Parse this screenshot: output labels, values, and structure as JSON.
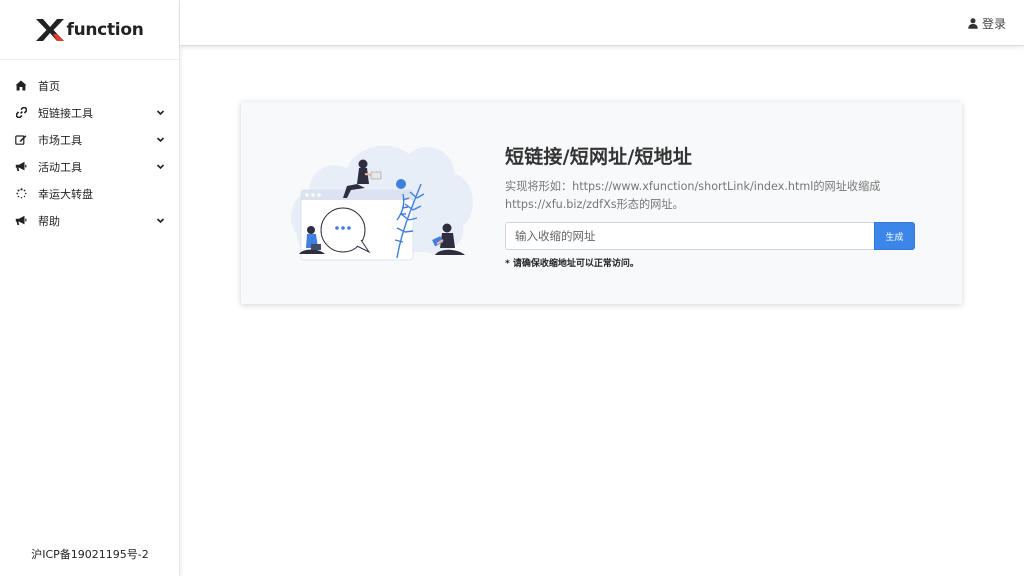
{
  "brand": {
    "logo_text": "function",
    "accent": "#e23b2b"
  },
  "sidebar": {
    "items": [
      {
        "label": "首页",
        "icon": "home-icon",
        "has_submenu": false
      },
      {
        "label": "短链接工具",
        "icon": "link-icon",
        "has_submenu": true
      },
      {
        "label": "市场工具",
        "icon": "edit-icon",
        "has_submenu": true
      },
      {
        "label": "活动工具",
        "icon": "megaphone-icon",
        "has_submenu": true
      },
      {
        "label": "幸运大转盘",
        "icon": "spinner-icon",
        "has_submenu": false
      },
      {
        "label": "帮助",
        "icon": "megaphone-icon",
        "has_submenu": true
      }
    ],
    "footer": "沪ICP备19021195号-2"
  },
  "header": {
    "login_label": "登录"
  },
  "main": {
    "title": "短链接/短网址/短地址",
    "description": "实现将形如：https://www.xfunction/shortLink/index.html的网址收缩成https://xfu.biz/zdfXs形态的网址。",
    "input_placeholder": "输入收缩的网址",
    "input_value": "",
    "button_label": "生成",
    "note": "* 请确保收缩地址可以正常访问。"
  },
  "colors": {
    "primary": "#3b86e8",
    "illustration_blue": "#3f7fe0",
    "illustration_bg": "#e8eef8"
  }
}
